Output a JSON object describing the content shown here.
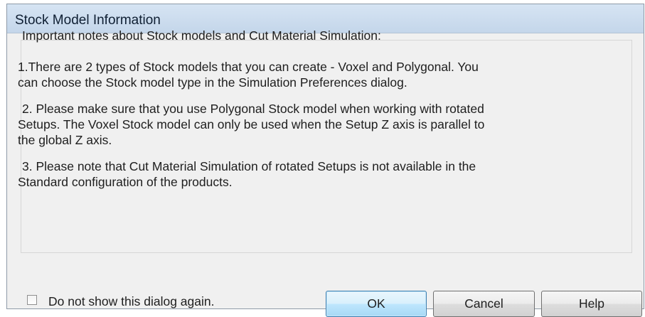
{
  "dialog": {
    "title": "Stock Model Information"
  },
  "notes": {
    "heading": "Important notes about Stock models and Cut Material Simulation:",
    "note1_line1": "1.There are 2 types of Stock models that you can create - Voxel and Polygonal.  You",
    "note1_line2": "can choose the Stock model type in the Simulation Preferences dialog.",
    "note2_line1": "2. Please make sure that you use Polygonal Stock model when working with rotated",
    "note2_line2": "Setups.  The Voxel Stock model can only be used when the Setup Z axis is parallel to",
    "note2_line3": "the global Z axis.",
    "note3_line1": "3. Please note that Cut Material Simulation of rotated Setups is not available in the",
    "note3_line2": "Standard configuration of the products."
  },
  "footer": {
    "dont_show_label": "Do not show this dialog again.",
    "dont_show_checked": false,
    "ok_label": "OK",
    "cancel_label": "Cancel",
    "help_label": "Help"
  }
}
